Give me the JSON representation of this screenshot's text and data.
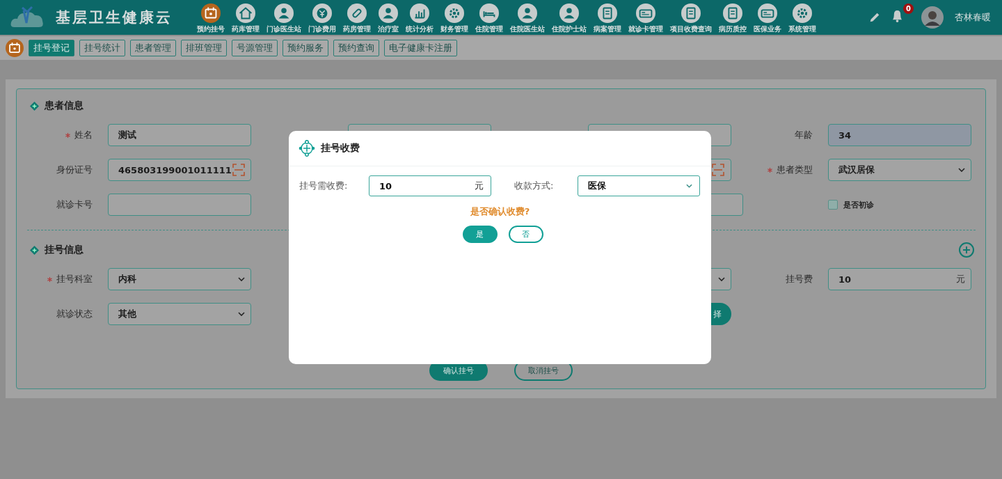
{
  "header": {
    "title": "基层卫生健康云",
    "nav": [
      {
        "label": "预约挂号",
        "selected": true
      },
      {
        "label": "药库管理",
        "selected": false
      },
      {
        "label": "门诊医生站",
        "selected": false
      },
      {
        "label": "门诊费用",
        "selected": false
      },
      {
        "label": "药房管理",
        "selected": false
      },
      {
        "label": "治疗室",
        "selected": false
      },
      {
        "label": "统计分析",
        "selected": false
      },
      {
        "label": "财务管理",
        "selected": false
      },
      {
        "label": "住院管理",
        "selected": false
      },
      {
        "label": "住院医生站",
        "selected": false
      },
      {
        "label": "住院护士站",
        "selected": false
      },
      {
        "label": "病案管理",
        "selected": false
      },
      {
        "label": "就诊卡管理",
        "selected": false
      },
      {
        "label": "项目收费查询",
        "selected": false
      },
      {
        "label": "病历质控",
        "selected": false
      },
      {
        "label": "医保业务",
        "selected": false
      },
      {
        "label": "系统管理",
        "selected": false
      }
    ],
    "notifications": "0",
    "user": "杏林春暖"
  },
  "subnav": {
    "tabs": [
      {
        "label": "挂号登记",
        "selected": true
      },
      {
        "label": "挂号统计",
        "selected": false
      },
      {
        "label": "患者管理",
        "selected": false
      },
      {
        "label": "排班管理",
        "selected": false
      },
      {
        "label": "号源管理",
        "selected": false
      },
      {
        "label": "预约服务",
        "selected": false
      },
      {
        "label": "预约查询",
        "selected": false
      },
      {
        "label": "电子健康卡注册",
        "selected": false
      }
    ]
  },
  "patient_info": {
    "title": "患者信息",
    "rows": [
      [
        {
          "kind": "input",
          "label": "姓名",
          "required": true,
          "value": "测试",
          "disabled": false,
          "scan": false
        },
        {
          "kind": "covered"
        },
        {
          "kind": "covered"
        },
        {
          "kind": "input",
          "label": "年龄",
          "required": false,
          "value": "34",
          "disabled": true,
          "scan": false
        }
      ],
      [
        {
          "kind": "input",
          "label": "身份证号",
          "required": false,
          "value": "465803199001011111",
          "disabled": false,
          "scan": true
        },
        {
          "kind": "hidden"
        },
        {
          "kind": "covered",
          "scan": true
        },
        {
          "kind": "select",
          "label": "患者类型",
          "required": true,
          "value": "武汉居保"
        }
      ],
      [
        {
          "kind": "input",
          "label": "就诊卡号",
          "required": false,
          "disabled": false,
          "scan": false
        },
        {
          "kind": "hidden"
        },
        {
          "kind": "covered_wide"
        },
        {
          "kind": "checkbox",
          "label": "是否初诊",
          "checked": false
        }
      ]
    ]
  },
  "registration_info": {
    "title": "挂号信息",
    "rows": [
      [
        {
          "kind": "select",
          "label": "挂号科室",
          "required": true,
          "value": "内科"
        },
        {
          "kind": "hidden"
        },
        {
          "kind": "covered_select"
        },
        {
          "kind": "input",
          "label": "挂号费",
          "required": false,
          "value": "10",
          "unit": "元",
          "disabled": false,
          "scan": false
        }
      ],
      [
        {
          "kind": "select",
          "label": "就诊状态",
          "required": false,
          "value": "其他"
        },
        {
          "kind": "hidden"
        },
        {
          "kind": "covered_button",
          "label": "择"
        },
        {
          "kind": "hidden"
        }
      ]
    ],
    "actions": [
      {
        "label": "确认挂号",
        "primary": true
      },
      {
        "label": "取消挂号",
        "primary": false
      }
    ]
  },
  "dialog": {
    "title": "挂号收费",
    "fee_label": "挂号需收费:",
    "fee_value": "10",
    "fee_unit": "元",
    "method_label": "收款方式:",
    "method_value": "医保",
    "prompt": "是否确认收费?",
    "buttons": [
      {
        "label": "是",
        "primary": true
      },
      {
        "label": "否",
        "primary": false
      }
    ]
  }
}
